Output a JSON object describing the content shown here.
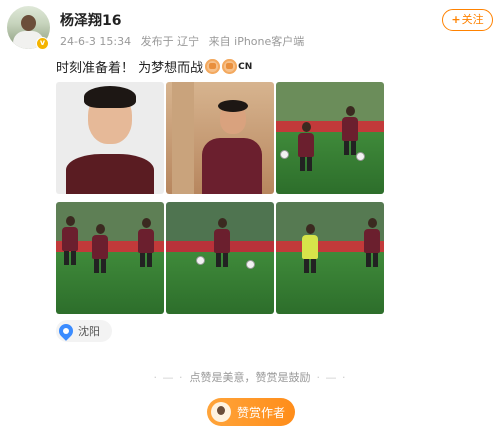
{
  "user": {
    "name": "杨泽翔16",
    "avatar_icon": "user-avatar",
    "verified_badge": "v"
  },
  "post": {
    "date": "24-6-3 15:34",
    "publish_label": "发布于 辽宁",
    "source": "来自 iPhone客户端",
    "text": "时刻准备着！ 为梦想而战",
    "emoji_suffix": "CN"
  },
  "follow_button": {
    "plus": "+",
    "label": "关注"
  },
  "photos": [
    {
      "name": "portrait"
    },
    {
      "name": "bus-photo"
    },
    {
      "name": "training-1"
    },
    {
      "name": "training-2"
    },
    {
      "name": "training-3"
    },
    {
      "name": "training-4"
    }
  ],
  "location": {
    "label": "沈阳",
    "icon": "location-pin-icon",
    "color": "#3b8cff"
  },
  "reward": {
    "hint": "点赞是美意，赞赏是鼓励",
    "button_label": "赞赏作者",
    "accent": "#ff8200"
  }
}
